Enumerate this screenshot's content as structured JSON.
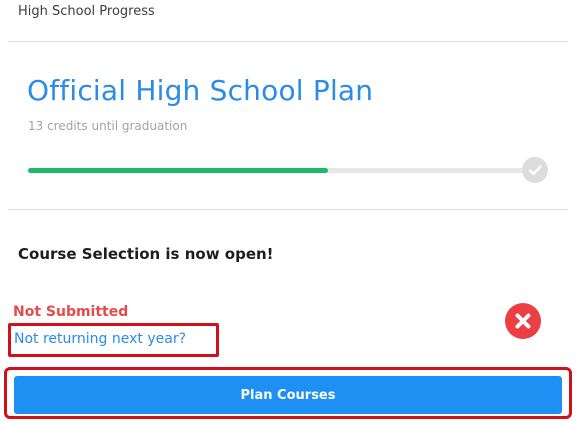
{
  "header": {
    "title": "High School Progress"
  },
  "plan": {
    "title": "Official High School Plan",
    "credits_text": "13 credits until graduation",
    "progress_fraction": 0.6
  },
  "course_selection": {
    "heading": "Course Selection is now open!",
    "status": "Not Submitted",
    "not_returning_link": "Not returning next year?",
    "plan_button": "Plan Courses"
  },
  "icons": {
    "progress_end": "checkmark-icon",
    "status": "close-circle-icon"
  },
  "colors": {
    "accent_blue": "#2a8be8",
    "button_blue": "#1e90f4",
    "progress_green": "#1fb86a",
    "error_red": "#e64a4a",
    "highlight_red": "#d0101b"
  }
}
